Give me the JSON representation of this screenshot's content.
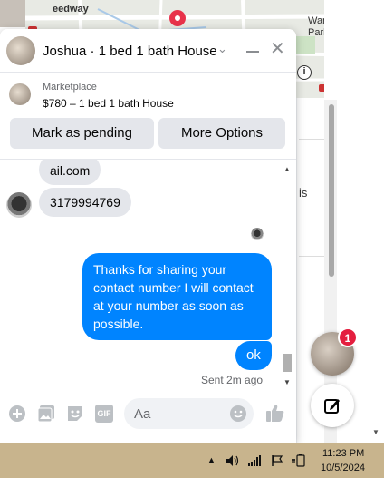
{
  "background": {
    "map_labels": {
      "speedway": "eedway",
      "warren_line1": "Warren",
      "warren_line2": "Park"
    },
    "snippet_text": "is"
  },
  "chat": {
    "header": {
      "title": "Joshua · 1 bed 1 bath House"
    },
    "marketplace": {
      "label": "Marketplace",
      "listing": "$780 – 1 bed 1 bath House",
      "mark_pending_label": "Mark as pending",
      "more_options_label": "More Options"
    },
    "messages": {
      "incoming_partial": "ail.com",
      "incoming_phone": "3179994769",
      "outgoing_long": "Thanks for sharing your contact number I will contact at your number as soon as possible.",
      "outgoing_short": "ok",
      "sent_time": "Sent 2m ago"
    },
    "composer": {
      "placeholder": "Aa",
      "gif_label": "GIF"
    }
  },
  "floating": {
    "badge_count": "1"
  },
  "taskbar": {
    "time": "11:23 PM",
    "date": "10/5/2024"
  },
  "colors": {
    "messenger_blue": "#0084ff",
    "badge_red": "#e41e3f",
    "taskbar": "#c8b48d"
  }
}
